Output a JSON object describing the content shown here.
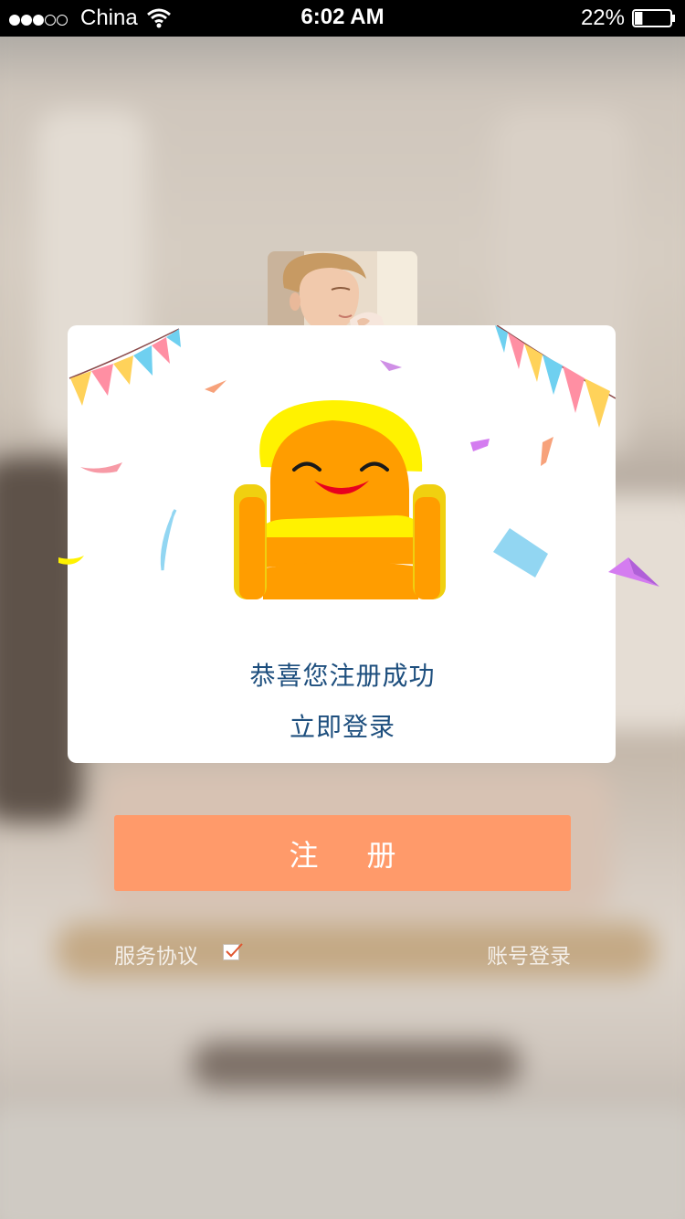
{
  "status_bar": {
    "carrier": "China",
    "time": "6:02 AM",
    "battery": "22%",
    "battery_level": 0.22,
    "signal_bars": 3,
    "signal_total": 5
  },
  "dialog": {
    "message": "恭喜您注册成功",
    "login_link": "立即登录",
    "illustration": "smiling-sofa-icon"
  },
  "register_button": {
    "label_first": "注",
    "label_second": "册"
  },
  "footer": {
    "agreement_label": "服务协议",
    "agreement_checked": true,
    "account_login": "账号登录"
  },
  "colors": {
    "accent": "#ff9a6a",
    "text_blue": "#1e4f7e",
    "sofa_yellow": "#ffee00",
    "sofa_orange": "#ff9d00"
  }
}
